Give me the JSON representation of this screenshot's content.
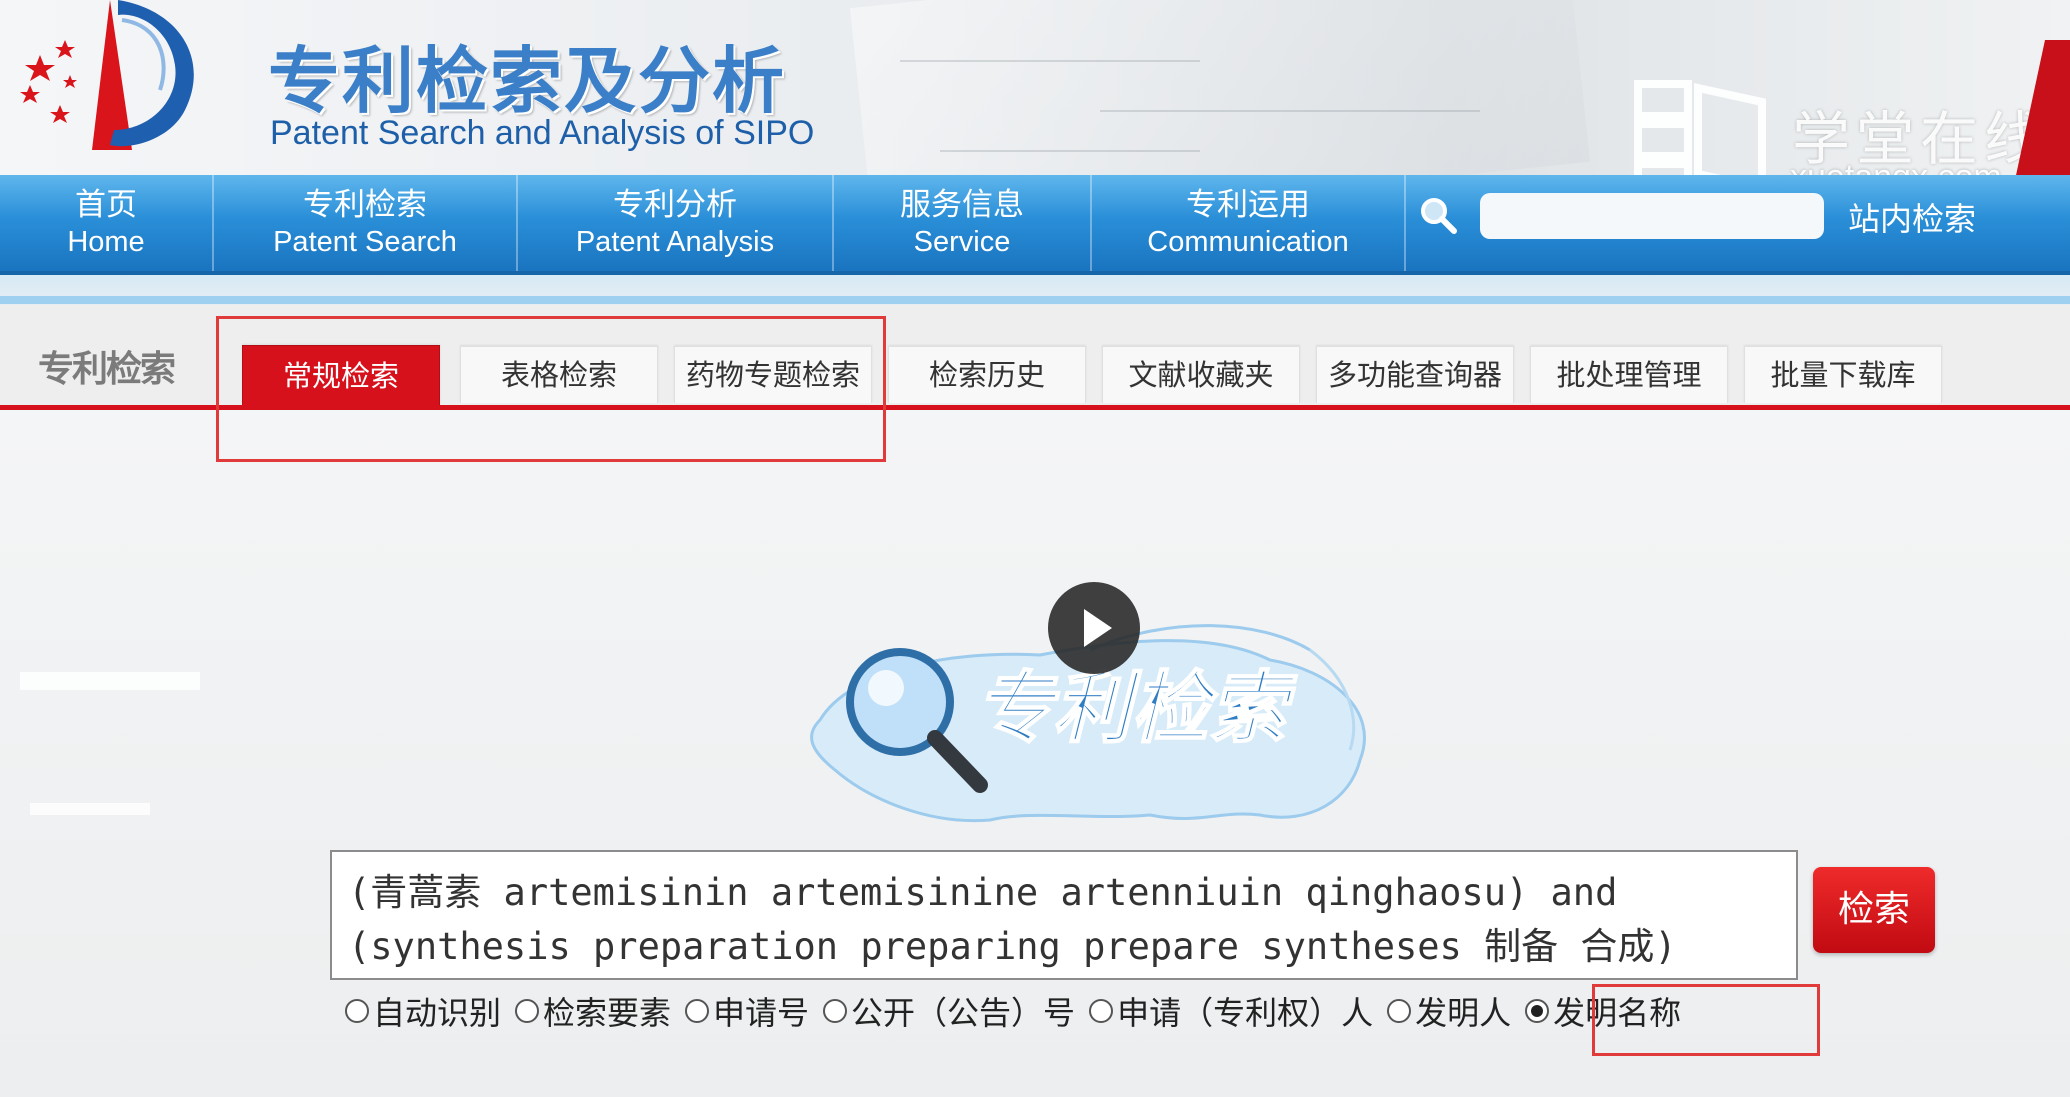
{
  "header": {
    "title": "专利检索及分析",
    "subtitle": "Patent Search and Analysis of SIPO"
  },
  "watermark": {
    "name": "学堂在线",
    "url": "xuetangx.com"
  },
  "nav": {
    "items": [
      {
        "cn": "首页",
        "en": "Home"
      },
      {
        "cn": "专利检索",
        "en": "Patent Search"
      },
      {
        "cn": "专利分析",
        "en": "Patent Analysis"
      },
      {
        "cn": "服务信息",
        "en": "Service"
      },
      {
        "cn": "专利运用",
        "en": "Communication"
      }
    ],
    "site_search_label": "站内检索"
  },
  "section_logo": "专利检索",
  "tabs": [
    {
      "label": "常规检索",
      "active": true
    },
    {
      "label": "表格检索"
    },
    {
      "label": "药物专题检索"
    },
    {
      "label": "检索历史"
    },
    {
      "label": "文献收藏夹"
    },
    {
      "label": "多功能查询器"
    },
    {
      "label": "批处理管理"
    },
    {
      "label": "批量下载库"
    }
  ],
  "main": {
    "logo_text": "专利检索",
    "query_line1": "(青蒿素 artemisinin artemisinine artenniuin qinghaosu) and",
    "query_line2": "(synthesis preparation preparing prepare syntheses 制备 合成)",
    "search_button": "检索",
    "search_types": [
      {
        "label": "自动识别",
        "checked": false
      },
      {
        "label": "检索要素",
        "checked": false
      },
      {
        "label": "申请号",
        "checked": false
      },
      {
        "label": "公开（公告）号",
        "checked": false
      },
      {
        "label": "申请（专利权）人",
        "checked": false
      },
      {
        "label": "发明人",
        "checked": false
      },
      {
        "label": "发明名称",
        "checked": true
      }
    ]
  },
  "colors": {
    "accent_red": "#d6111b",
    "nav_blue": "#1a74c0",
    "title_blue": "#3b7fc8"
  }
}
